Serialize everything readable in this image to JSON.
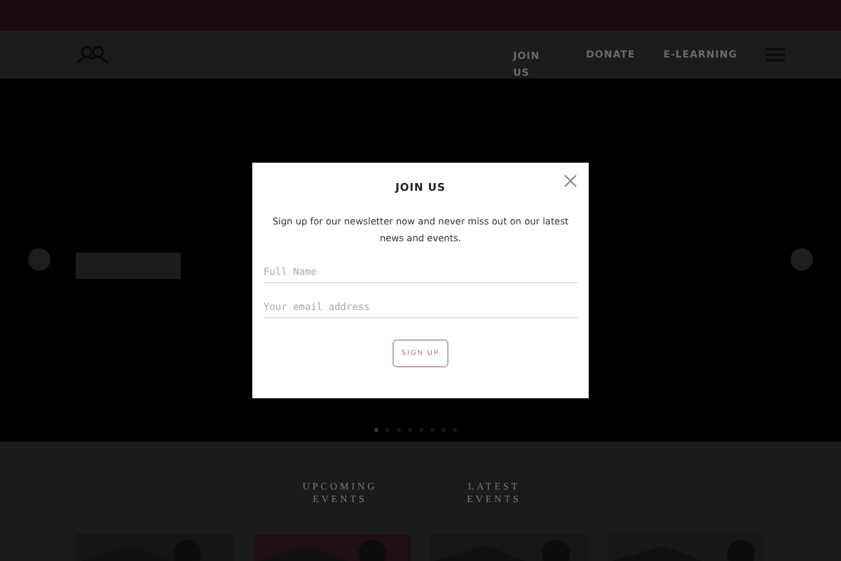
{
  "nav": {
    "items": [
      {
        "label": "JOIN US"
      },
      {
        "label": "DONATE"
      },
      {
        "label": "E-LEARNING"
      }
    ]
  },
  "slider": {
    "dots": [
      {
        "selected": true
      },
      {
        "selected": false
      },
      {
        "selected": false
      },
      {
        "selected": false
      },
      {
        "selected": false
      },
      {
        "selected": false
      },
      {
        "selected": false
      },
      {
        "selected": false
      }
    ]
  },
  "sections": {
    "tabs": [
      {
        "label": "UPCOMING EVENTS"
      },
      {
        "label": "LATEST EVENTS"
      }
    ]
  },
  "modal": {
    "title": "JOIN US",
    "text": "Sign up for our newsletter now and never miss out on our latest news and events.",
    "fields": [
      {
        "placeholder": "Full Name"
      },
      {
        "placeholder": "Your email address"
      }
    ],
    "button": "SIGN UP"
  }
}
